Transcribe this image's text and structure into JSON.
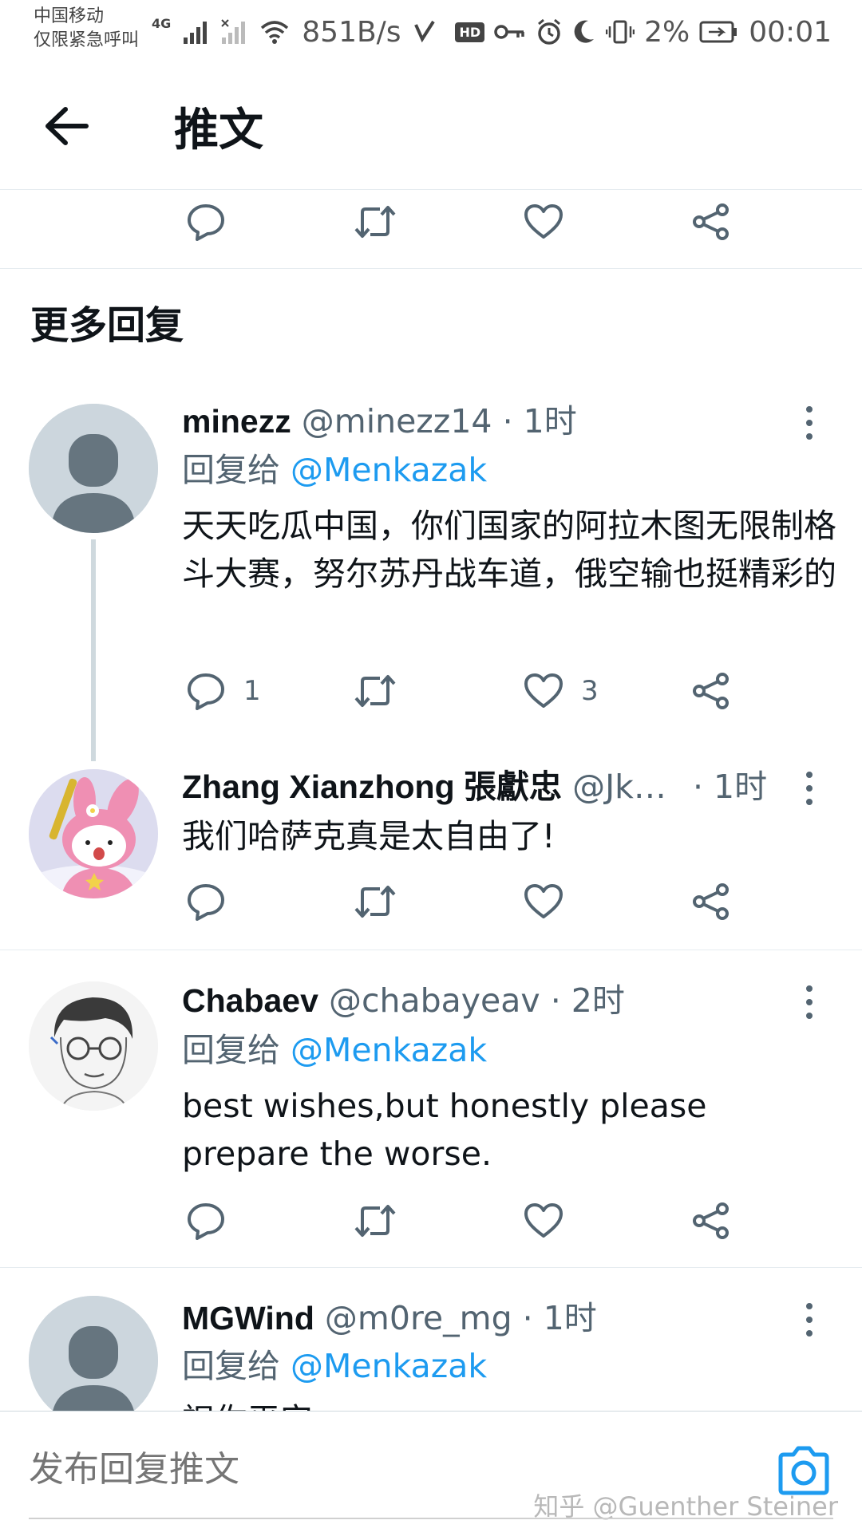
{
  "status_bar": {
    "carrier_line1": "中国移动",
    "carrier_line2": "仅限紧急呼叫",
    "network": "4G",
    "speed": "851B/s",
    "hd": "HD",
    "battery": "2%",
    "time": "00:01"
  },
  "header": {
    "title": "推文"
  },
  "section": {
    "title": "更多回复"
  },
  "tweets": [
    {
      "name": "minezz",
      "handle": "@minezz14",
      "time": "· 1时",
      "reply_prefix": "回复给",
      "reply_to": "@Menkazak",
      "text": "天天吃瓜中国，你们国家的阿拉木图无限制格斗大赛，努尔苏丹战车道，俄空输也挺精彩的",
      "reply_count": "1",
      "like_count": "3"
    },
    {
      "name": "Zhang Xianzhong 張獻忠",
      "handle": "@Jk…",
      "time": "· 1时",
      "text": "我们哈萨克真是太自由了!"
    },
    {
      "name": "Chabaev",
      "handle": "@chabayeav",
      "time": "· 2时",
      "reply_prefix": "回复给",
      "reply_to": "@Menkazak",
      "text": "best wishes,but honestly please prepare the worse."
    },
    {
      "name": "MGWind",
      "handle": "@m0re_mg",
      "time": "· 1时",
      "reply_prefix": "回复给",
      "reply_to": "@Menkazak",
      "text": "祝你平安"
    }
  ],
  "composer": {
    "placeholder": "发布回复推文"
  },
  "watermark": "知乎 @Guenther Steiner",
  "colors": {
    "accent": "#1d9bf0",
    "secondary_text": "#536471",
    "primary_text": "#0f1419",
    "divider": "#e6ecf0"
  }
}
